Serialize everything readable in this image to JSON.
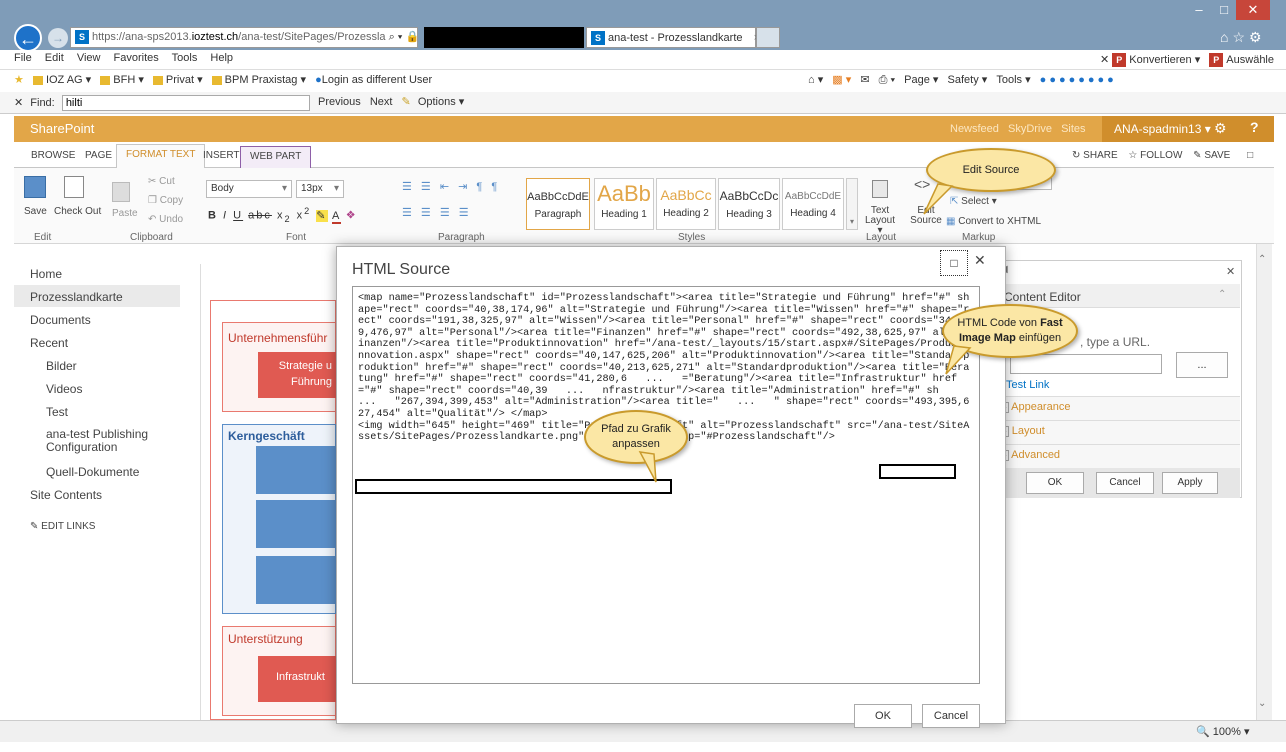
{
  "browser": {
    "address_host": "https://ana-sps2013.",
    "address_domain": "ioztest.ch",
    "address_path": "/ana-test/SitePages/Prozessla",
    "address_controls": "⌕ ▾ 🔒 C",
    "active_tab": "ana-test - Prozesslandkarte",
    "tab_close": "×",
    "menu": [
      "File",
      "Edit",
      "View",
      "Favorites",
      "Tools",
      "Help"
    ],
    "favorites": [
      "IOZ AG ▾",
      "BFH ▾",
      "Privat ▾",
      "BPM Praxistag ▾",
      "Login as different User"
    ],
    "right_tools": [
      "Page ▾",
      "Safety ▾",
      "Tools ▾"
    ],
    "addons": [
      "Konvertieren ▾",
      "Auswähle"
    ],
    "find_label": "Find:",
    "find_value": "hilti",
    "find_previous": "Previous",
    "find_next": "Next",
    "find_options": "Options ▾",
    "zoom": "100%"
  },
  "sharepoint": {
    "brand": "SharePoint",
    "top_links": [
      "Newsfeed",
      "SkyDrive",
      "Sites"
    ],
    "user": "ANA-spadmin13 ▾",
    "ribbon_tabs": [
      "BROWSE",
      "PAGE",
      "FORMAT TEXT",
      "INSERT",
      "WEB PART"
    ],
    "share": "SHARE",
    "follow": "FOLLOW",
    "save": "SAVE",
    "ribbon": {
      "save": "Save",
      "checkout": "Check Out",
      "paste": "Paste",
      "cut": "Cut",
      "copy": "Copy",
      "undo": "Undo",
      "font_name": "Body",
      "font_size": "13px",
      "styles": [
        {
          "sample": "AaBbCcDdE",
          "label": "Paragraph"
        },
        {
          "sample": "AaBb",
          "label": "Heading 1"
        },
        {
          "sample": "AaBbCc",
          "label": "Heading 2"
        },
        {
          "sample": "AaBbCcDc",
          "label": "Heading 3"
        },
        {
          "sample": "AaBbCcDdE",
          "label": "Heading 4"
        }
      ],
      "text_layout": "Text Layout ▾",
      "edit_source": "Edit Source",
      "select": "Select ▾",
      "convert": "Convert to XHTML",
      "groups": [
        "Edit",
        "Clipboard",
        "Font",
        "Paragraph",
        "Styles",
        "Layout",
        "Markup"
      ]
    },
    "nav": [
      "Home",
      "Prozesslandkarte",
      "Documents",
      "Recent",
      "Bilder",
      "Videos",
      "Test",
      "ana-test Publishing Configuration",
      "Quell-Dokumente",
      "Site Contents",
      "EDIT LINKS"
    ],
    "canvas": {
      "box1_title": "Unternehmensführ",
      "box1_item": "Strategie u Führung",
      "box2_title": "Kerngeschäft",
      "box3_title": "Unterstützung",
      "box3_item": "Infrastrukt"
    },
    "webpart_panel": {
      "title": "Content Editor",
      "hint": ", type a URL.",
      "browse": "...",
      "test_link": "Test Link",
      "sections": [
        "Appearance",
        "Layout",
        "Advanced"
      ],
      "ok": "OK",
      "cancel": "Cancel",
      "apply": "Apply"
    }
  },
  "dialog": {
    "title": "HTML Source",
    "code": "<map name=\"Prozesslandschaft\" id=\"Prozesslandschaft\"><area title=\"Strategie und Führung\" href=\"#\" shape=\"rect\" coords=\"40,38,174,96\" alt=\"Strategie und Führung\"/><area title=\"Wissen\" href=\"#\" shape=\"rect\" coords=\"191,38,325,97\" alt=\"Wissen\"/><area title=\"Personal\" href=\"#\" shape=\"rect\" coords=\"342,39,476,97\" alt=\"Personal\"/><area title=\"Finanzen\" href=\"#\" shape=\"rect\" coords=\"492,38,625,97\" alt=\"Finanzen\"/><area title=\"Produktinnovation\" href=\"/ana-test/_layouts/15/start.aspx#/SitePages/Produktinnovation.aspx\" shape=\"rect\" coords=\"40,147,625,206\" alt=\"Produktinnovation\"/><area title=\"Standardproduktion\" href=\"#\" shape=\"rect\" coords=\"40,213,625,271\" alt=\"Standardproduktion\"/><area title=\"Beratung\" href=\"#\" shape=\"rect\" coords=\"41,280,6   ...   =\"Beratung\"/><area title=\"Infrastruktur\" href=\"#\" shape=\"rect\" coords=\"40,39   ...   nfrastruktur\"/><area title=\"Administration\" href=\"#\" sh   ...   \"267,394,399,453\" alt=\"Administration\"/><area title=\"   ...   \" shape=\"rect\" coords=\"493,395,627,454\" alt=\"Qualität\"/> </map>\n<img width=\"645\" height=\"469\" title=\"Prozesslandschaft\" alt=\"Prozesslandschaft\" src=\"/ana-test/SiteAssets/SitePages/Prozesslandkarte.png\" border=\"0\" usemap=\"#Prozesslandschaft\"/>",
    "ok": "OK",
    "cancel": "Cancel"
  },
  "callouts": {
    "edit_source": "Edit Source",
    "html_code_prefix": "HTML Code von ",
    "html_code_bold": "Fast Image Map",
    "html_code_suffix": " einfügen",
    "path": "Pfad zu Grafik anpassen"
  }
}
